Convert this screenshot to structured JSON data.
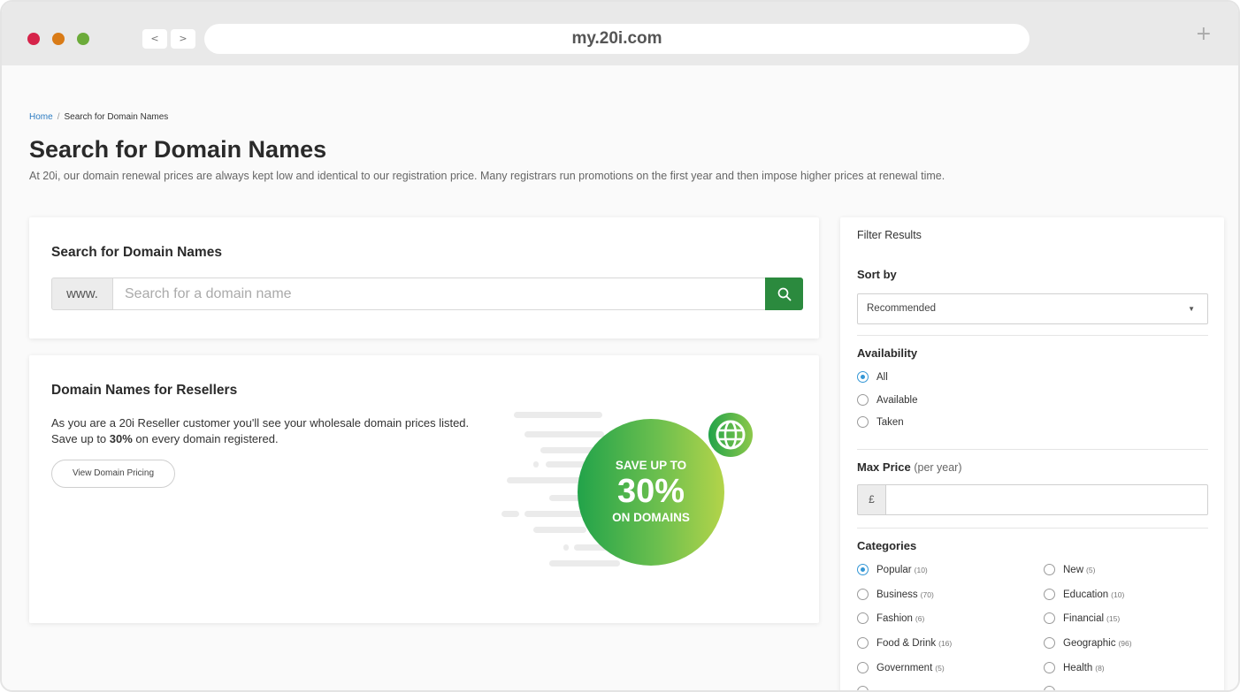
{
  "browser": {
    "url": "my.20i.com",
    "back_label": "<",
    "forward_label": ">",
    "new_tab_label": "+",
    "traffic_lights": [
      "#d6244a",
      "#d97b17",
      "#6cab3a"
    ]
  },
  "breadcrumb": {
    "home": "Home",
    "separator": "/",
    "current": "Search for Domain Names"
  },
  "page": {
    "title": "Search for Domain Names",
    "subtitle": "At 20i, our domain renewal prices are always kept low and identical to our registration price. Many registrars run promotions on the first year and then impose higher prices at renewal time."
  },
  "search_card": {
    "heading": "Search for Domain Names",
    "prefix": "www.",
    "placeholder": "Search for a domain name",
    "value": "",
    "button_icon": "search-icon",
    "button_color": "#2b8a3e"
  },
  "resellers_card": {
    "heading": "Domain Names for Resellers",
    "text_before": "As you are a 20i Reseller customer you'll see your wholesale domain prices listed. Save up to ",
    "text_bold": "30%",
    "text_after": " on every domain registered.",
    "button_label": "View Domain Pricing",
    "promo_line1": "SAVE UP TO",
    "promo_line2": "30%",
    "promo_line3": "ON DOMAINS",
    "promo_icon": "globe-icon"
  },
  "filters": {
    "title": "Filter Results",
    "sort_label": "Sort by",
    "sort_value": "Recommended",
    "availability_label": "Availability",
    "availability_options": [
      {
        "label": "All",
        "selected": true
      },
      {
        "label": "Available",
        "selected": false
      },
      {
        "label": "Taken",
        "selected": false
      }
    ],
    "max_price_label": "Max Price",
    "max_price_suffix": "(per year)",
    "currency_symbol": "£",
    "max_price_value": "",
    "categories_label": "Categories",
    "categories": [
      {
        "label": "Popular",
        "count": "(10)",
        "selected": true
      },
      {
        "label": "New",
        "count": "(5)",
        "selected": false
      },
      {
        "label": "Business",
        "count": "(70)",
        "selected": false
      },
      {
        "label": "Education",
        "count": "(10)",
        "selected": false
      },
      {
        "label": "Fashion",
        "count": "(6)",
        "selected": false
      },
      {
        "label": "Financial",
        "count": "(15)",
        "selected": false
      },
      {
        "label": "Food & Drink",
        "count": "(16)",
        "selected": false
      },
      {
        "label": "Geographic",
        "count": "(96)",
        "selected": false
      },
      {
        "label": "Government",
        "count": "(5)",
        "selected": false
      },
      {
        "label": "Health",
        "count": "(8)",
        "selected": false
      }
    ],
    "accent_color": "#3497d6"
  }
}
